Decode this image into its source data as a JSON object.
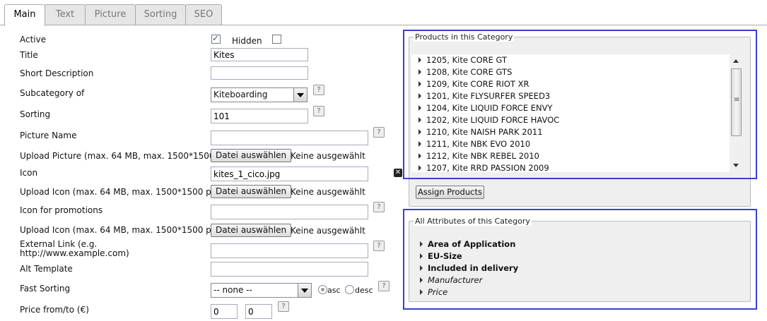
{
  "tabs": [
    "Main",
    "Text",
    "Picture",
    "Sorting",
    "SEO"
  ],
  "form": {
    "active_label": "Active",
    "hidden_label": "Hidden",
    "title_label": "Title",
    "title_value": "Kites",
    "short_description_label": "Short Description",
    "subcategory_label": "Subcategory of",
    "subcategory_value": "Kiteboarding",
    "sorting_label": "Sorting",
    "sorting_value": "101",
    "picture_name_label": "Picture Name",
    "upload_picture_label": "Upload Picture (max. 64 MB, max. 1500*1500 px)",
    "icon_label": "Icon",
    "icon_value": "kites_1_cico.jpg",
    "upload_icon_label": "Upload Icon (max. 64 MB, max. 1500*1500 px)",
    "icon_promotions_label": "Icon for promotions",
    "upload_icon2_label": "Upload Icon (max. 64 MB, max. 1500*1500 px)",
    "external_link_label_1": "External Link (e.g.",
    "external_link_label_2": "http://www.example.com)",
    "alt_template_label": "Alt Template",
    "fast_sorting_label": "Fast Sorting",
    "fast_sorting_value": "-- none --",
    "asc_label": "asc",
    "desc_label": "desc",
    "price_label": "Price from/to (€)",
    "price_from": "0",
    "price_to": "0",
    "file_button": "Datei auswählen",
    "no_file": "Keine ausgewählt",
    "help": "?",
    "active_checked": true,
    "hidden_checked": false
  },
  "products_panel": {
    "legend": "Products in this Category",
    "items": [
      "1205,  Kite CORE GT",
      "1208,  Kite CORE GTS",
      "1209,  Kite CORE RIOT XR",
      "1201,  Kite FLYSURFER SPEED3",
      "1204,  Kite LIQUID FORCE ENVY",
      "1202,  Kite LIQUID FORCE HAVOC",
      "1210,  Kite NAISH PARK 2011",
      "1211,  Kite NBK EVO 2010",
      "1212,  Kite NBK REBEL 2010",
      "1207,  Kite RRD PASSION 2009"
    ],
    "assign_button": "Assign Products"
  },
  "attributes_panel": {
    "legend": "All Attributes of this Category",
    "items": [
      {
        "label": "Area of Application",
        "style": "b"
      },
      {
        "label": "EU-Size",
        "style": "b"
      },
      {
        "label": "Included in delivery",
        "style": "b"
      },
      {
        "label": "Manufacturer",
        "style": "i"
      },
      {
        "label": "Price",
        "style": "i"
      }
    ]
  }
}
